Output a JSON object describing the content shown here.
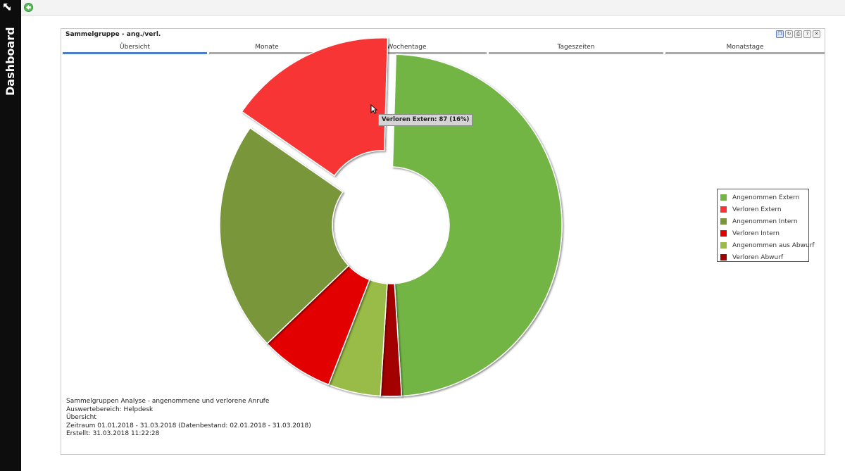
{
  "sidebar": {
    "title": "Dashboard",
    "collapse_icon": "expand-arrow-icon"
  },
  "toolbar": {
    "back_icon": "green-back-arrow-icon"
  },
  "panel": {
    "title": "Sammelgruppe - ang./verl.",
    "tools": [
      "copy-icon",
      "refresh-icon",
      "print-icon",
      "help-icon",
      "close-icon"
    ],
    "tool_glyphs": [
      "❐",
      "↻",
      "⎙",
      "?",
      "✕"
    ]
  },
  "tabs": [
    {
      "label": "Übersicht",
      "active": true
    },
    {
      "label": "Monate",
      "active": false
    },
    {
      "label": "Wochentage",
      "active": false
    },
    {
      "label": "Tageszeiten",
      "active": false
    },
    {
      "label": "Monatstage",
      "active": false
    }
  ],
  "chart_data": {
    "type": "pie",
    "variant": "donut",
    "exploded": "Verloren Extern",
    "legend_position": "right",
    "series": [
      {
        "name": "Angenommen Extern",
        "value": 49,
        "color": "#72b545"
      },
      {
        "name": "Verloren Abwurf",
        "value": 2,
        "color": "#a30000"
      },
      {
        "name": "Angenommen aus Abwurf",
        "value": 5,
        "color": "#99bb47"
      },
      {
        "name": "Verloren Intern",
        "value": 7,
        "color": "#e20000"
      },
      {
        "name": "Angenommen Intern",
        "value": 22,
        "color": "#79963a"
      },
      {
        "name": "Verloren Extern",
        "value": 16,
        "color": "#f83436"
      }
    ],
    "legend_order": [
      "Angenommen Extern",
      "Verloren Extern",
      "Angenommen Intern",
      "Verloren Intern",
      "Angenommen aus Abwurf",
      "Verloren Abwurf"
    ]
  },
  "tooltip": {
    "text": "Verloren Extern: 87 (16%)"
  },
  "footer": {
    "line1": "Sammelgruppen Analyse - angenommene und verlorene Anrufe",
    "line2": "Auswertebereich: Helpdesk",
    "line3": "Übersicht",
    "line4": "Zeitraum 01.01.2018 - 31.03.2018 (Datenbestand: 02.01.2018 - 31.03.2018)",
    "line5": "Erstellt: 31.03.2018 11:22:28"
  }
}
